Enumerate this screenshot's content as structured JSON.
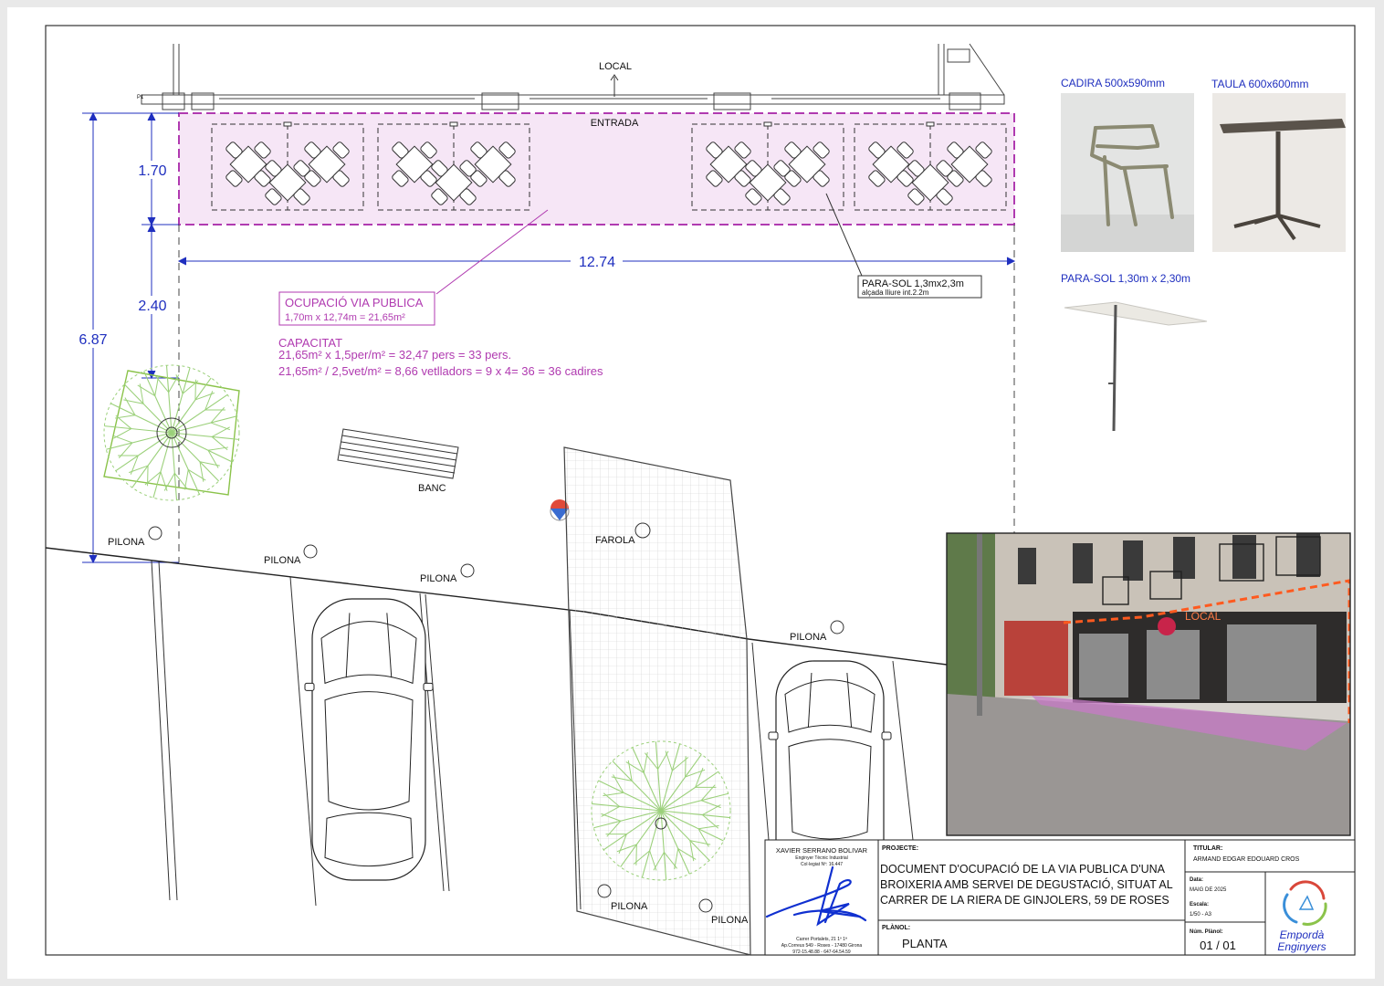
{
  "plan": {
    "local_label": "LOCAL",
    "entrada_label": "ENTRADA",
    "p1_label": "P1",
    "dim_width": "12.74",
    "dim_depth": "1.70",
    "dim_gap": "2.40",
    "dim_total": "6.87",
    "parasol_note": "PARA-SOL 1,3mx2,3m",
    "parasol_subnote": "alçada lliure int.2.2m",
    "ocupacio_title": "OCUPACIÓ VIA PUBLICA",
    "ocupacio_calc": "1,70m x 12,74m = 21,65m²",
    "capacitat_title": "CAPACITAT",
    "capacitat_line1": "21,65m² x 1,5per/m² = 32,47 pers = 33 pers.",
    "capacitat_line2": "21,65m² / 2,5vet/m² = 8,66 vetlladors = 9 x 4= 36 = 36 cadires",
    "banc_label": "BANC",
    "farola_label": "FAROLA",
    "pilona_label": "PILONA"
  },
  "products": {
    "chair_label": "CADIRA 500x590mm",
    "table_label": "TAULA 600x600mm",
    "parasol_label": "PARA-SOL  1,30m x 2,30m"
  },
  "photo": {
    "local_label": "LOCAL"
  },
  "titleblock": {
    "engineer_name": "XAVIER SERRANO BOLIVAR",
    "engineer_title": "Enginyer Tècnic Industrial",
    "engineer_number": "Col·legiat Nº: 16.447",
    "engineer_address1": "Carrer Portalets, 21 1º 1ª",
    "engineer_address2": "Ap.Correus 549 - Roses - 17480 Girona",
    "engineer_phone": "972-15.48.88  -  647-64.54.59",
    "projecte_label": "PROJECTE:",
    "project_line1": "DOCUMENT D'OCUPACIÓ DE LA VIA PUBLICA  D'UNA",
    "project_line2": "BROIXERIA AMB SERVEI DE DEGUSTACIÓ, SITUAT AL",
    "project_line3": "CARRER DE LA RIERA DE GINJOLERS, 59 DE ROSES",
    "planol_label": "PLÀNOL:",
    "planol_value": "PLANTA",
    "titular_label": "TITULAR:",
    "titular_value": "ARMAND EDGAR EDOUARD CROS",
    "data_label": "Data:",
    "data_value": "MAIG DE 2025",
    "escala_label": "Escala:",
    "escala_value": "1/50 - A3",
    "num_planol_label": "Núm. Plànol:",
    "num_planol_value": "01 / 01",
    "company_line1": "Empordà",
    "company_line2": "Enginyers"
  },
  "colors": {
    "dimension": "#1f2fbf",
    "occupation": "#b03ab0",
    "occupation_fill": "#f6e6f6",
    "tree": "#9bd07a",
    "highlight": "#ff5a1f"
  }
}
